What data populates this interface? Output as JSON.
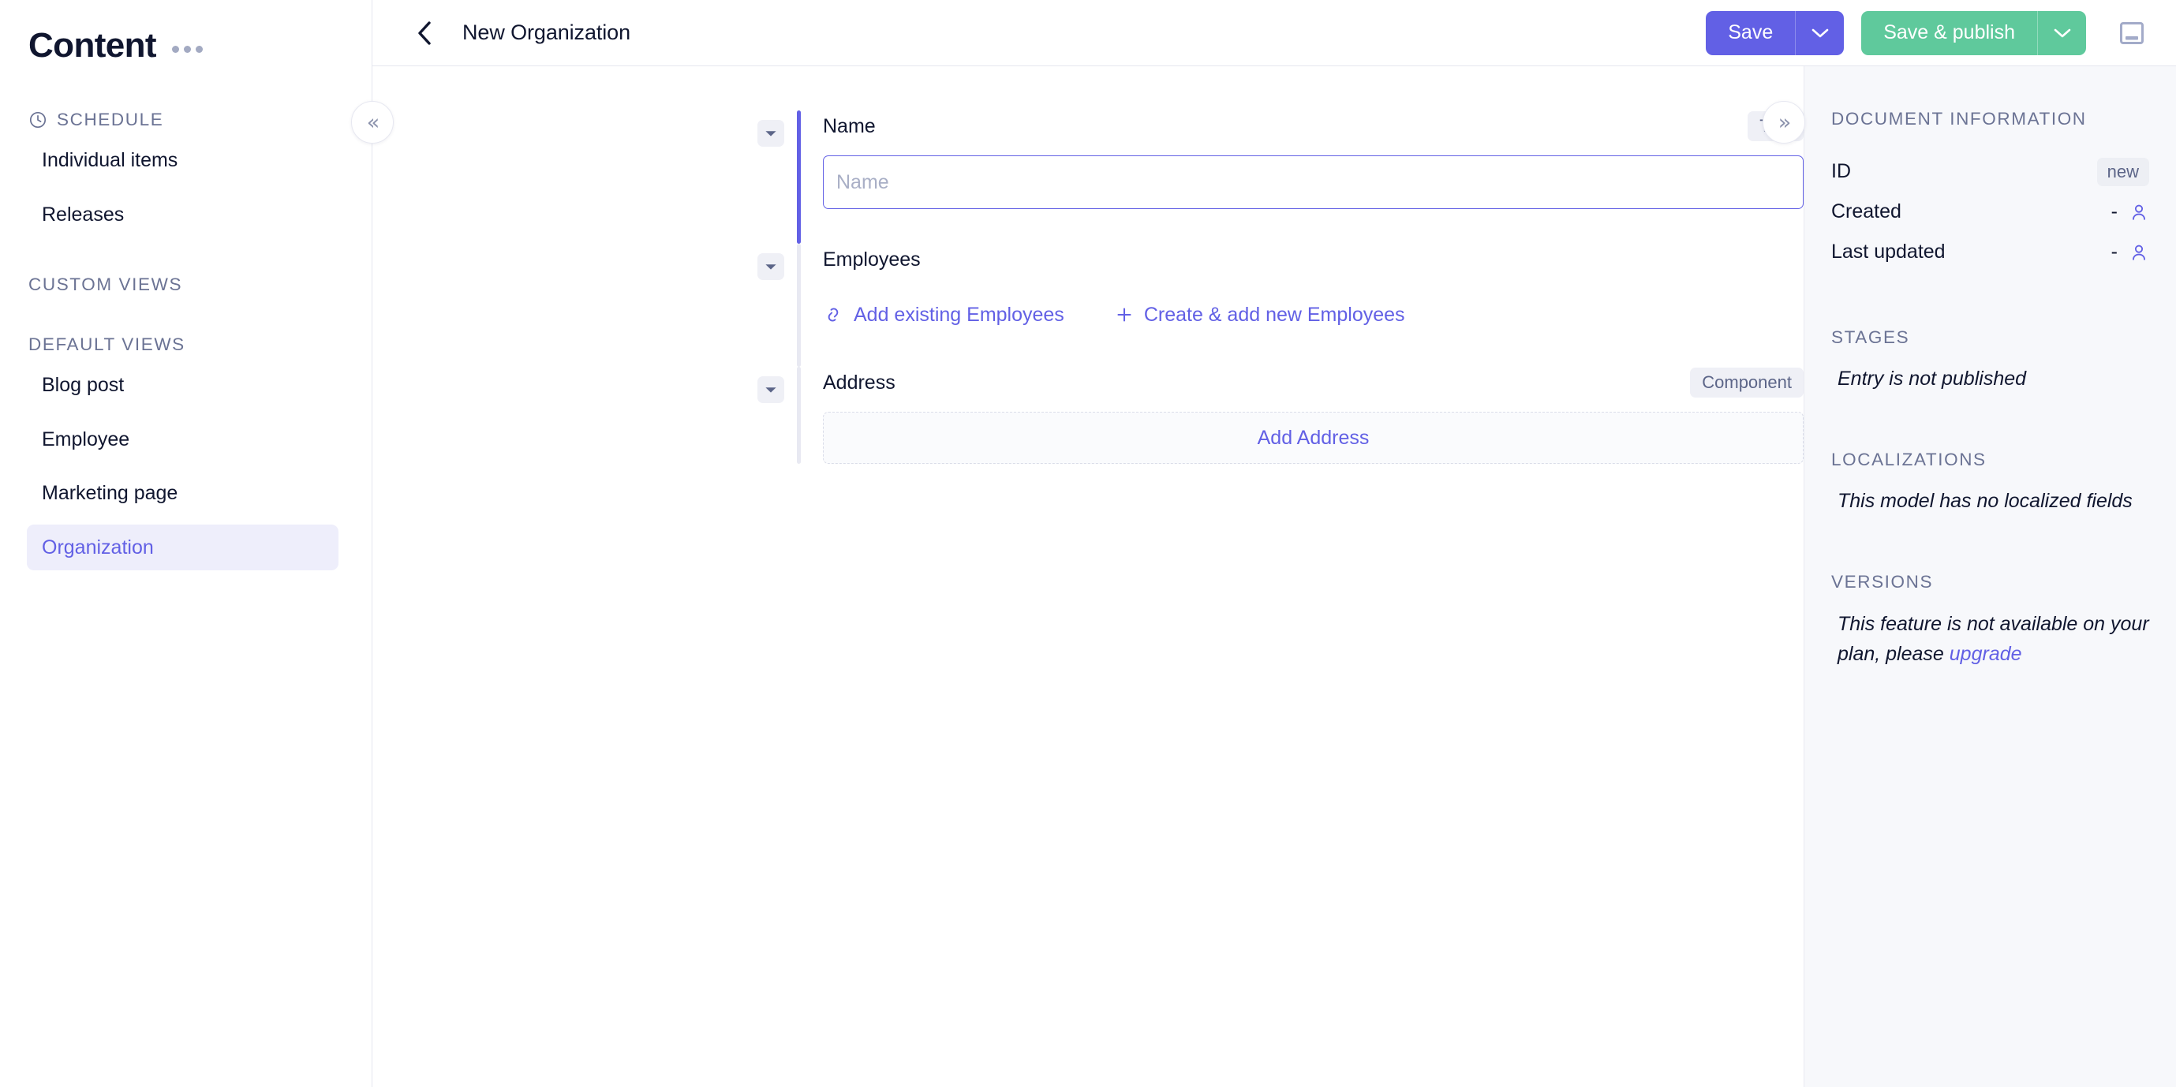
{
  "sidebar": {
    "title": "Content",
    "menu_icon": "ellipsis-icon",
    "sections": [
      {
        "label": "SCHEDULE",
        "icon": "clock-icon",
        "items": [
          {
            "label": "Individual items",
            "active": false
          },
          {
            "label": "Releases",
            "active": false
          }
        ]
      },
      {
        "label": "CUSTOM VIEWS",
        "icon": null,
        "items": []
      },
      {
        "label": "DEFAULT VIEWS",
        "icon": null,
        "items": [
          {
            "label": "Blog post",
            "active": false
          },
          {
            "label": "Employee",
            "active": false
          },
          {
            "label": "Marketing page",
            "active": false
          },
          {
            "label": "Organization",
            "active": true
          }
        ]
      }
    ]
  },
  "topbar": {
    "back_icon": "chevron-left-icon",
    "title": "New Organization",
    "save_label": "Save",
    "save_caret_icon": "chevron-down-icon",
    "publish_label": "Save & publish",
    "publish_caret_icon": "chevron-down-icon",
    "panel_toggle_icon": "panel-layout-icon"
  },
  "collapse": {
    "left_icon": "«",
    "right_icon": "»"
  },
  "form": {
    "fields": [
      {
        "name": "name",
        "label": "Name",
        "badge": "Title",
        "placeholder": "Name",
        "value": "",
        "toggle_icon": "chevron-down-icon",
        "focused": true
      },
      {
        "name": "employees",
        "label": "Employees",
        "badge": "",
        "toggle_icon": "chevron-down-icon",
        "focused": false,
        "actions": [
          {
            "label": "Add existing Employees",
            "icon": "link-icon"
          },
          {
            "label": "Create & add new Employees",
            "icon": "plus-icon"
          }
        ]
      },
      {
        "name": "address",
        "label": "Address",
        "badge": "Component",
        "toggle_icon": "chevron-down-icon",
        "focused": false,
        "add_label": "Add Address"
      }
    ]
  },
  "right_panel": {
    "document_information": {
      "label": "DOCUMENT INFORMATION",
      "rows": [
        {
          "label": "ID",
          "value": "new",
          "type": "badge"
        },
        {
          "label": "Created",
          "value": "-",
          "type": "user",
          "icon": "user-icon"
        },
        {
          "label": "Last updated",
          "value": "-",
          "type": "user",
          "icon": "user-icon"
        }
      ]
    },
    "stages": {
      "label": "STAGES",
      "note": "Entry is not published"
    },
    "localizations": {
      "label": "LOCALIZATIONS",
      "note": "This model has no localized fields"
    },
    "versions": {
      "label": "VERSIONS",
      "note_prefix": "This feature is not available on your plan, please ",
      "note_link": "upgrade"
    }
  },
  "colors": {
    "accent": "#6260E5",
    "success": "#5FC99C",
    "text": "#10162F",
    "muted": "#6B7394",
    "panel_bg": "#F7F8FB",
    "border": "#E4E6EF"
  }
}
